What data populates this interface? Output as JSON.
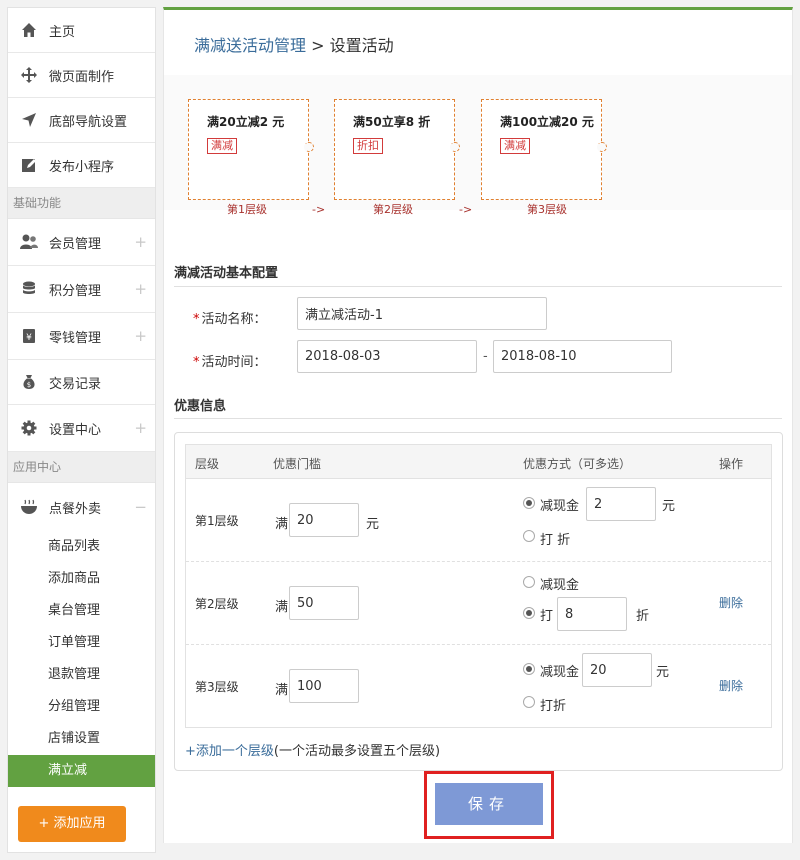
{
  "sidebar": {
    "top_items": [
      {
        "label": "主页",
        "icon": "home-icon"
      },
      {
        "label": "微页面制作",
        "icon": "move-icon"
      },
      {
        "label": "底部导航设置",
        "icon": "navigation-arrow-icon"
      },
      {
        "label": "发布小程序",
        "icon": "edit-icon"
      }
    ],
    "section_basic": "基础功能",
    "basic_items": [
      {
        "label": "会员管理",
        "icon": "users-icon",
        "expander": "+"
      },
      {
        "label": "积分管理",
        "icon": "database-icon",
        "expander": "+"
      },
      {
        "label": "零钱管理",
        "icon": "wallet-icon",
        "expander": "+"
      },
      {
        "label": "交易记录",
        "icon": "money-bag-icon"
      },
      {
        "label": "设置中心",
        "icon": "gear-icon",
        "expander": "+"
      }
    ],
    "section_apps": "应用中心",
    "app_item": {
      "label": "点餐外卖",
      "icon": "food-bowl-icon",
      "expander": "−"
    },
    "sub_items": [
      "商品列表",
      "添加商品",
      "桌台管理",
      "订单管理",
      "退款管理",
      "分组管理",
      "店铺设置",
      "满立减"
    ],
    "active_sub": "满立减",
    "add_app_label": "+ 添加应用"
  },
  "breadcrumb": {
    "link": "满减送活动管理",
    "separator": " > ",
    "current": "设置活动"
  },
  "tiers_preview": [
    {
      "title": "满20立减2 元",
      "tag": "满减",
      "level": "第1层级"
    },
    {
      "title": "满50立享8 折",
      "tag": "折扣",
      "level": "第2层级"
    },
    {
      "title": "满100立减20 元",
      "tag": "满减",
      "level": "第3层级"
    }
  ],
  "arrow_text": "->",
  "basic_config": {
    "heading": "满减活动基本配置",
    "name_label": "活动名称：",
    "name_value": "满立减活动-1",
    "time_label": "活动时间：",
    "start_date": "2018-08-03",
    "date_sep": "-",
    "end_date": "2018-08-10"
  },
  "discount": {
    "heading": "优惠信息",
    "headers": [
      "层级",
      "优惠门槛",
      "优惠方式（可多选）",
      "操作"
    ],
    "threshold_prefix": "满",
    "threshold_unit": "元",
    "rows": [
      {
        "level": "第1层级",
        "threshold": "20",
        "opt1_label": "减现金",
        "opt1_value": "2",
        "opt1_unit": "元",
        "opt2_label": "打 折",
        "selected": "opt1",
        "action": ""
      },
      {
        "level": "第2层级",
        "threshold": "50",
        "opt1_label": "减现金",
        "opt2_label": "打",
        "opt2_value": "8",
        "opt2_unit": "折",
        "selected": "opt2",
        "action": "删除"
      },
      {
        "level": "第3层级",
        "threshold": "100",
        "opt1_label": "减现金",
        "opt1_value": "20",
        "opt1_unit": "元",
        "opt2_label": "打折",
        "selected": "opt1",
        "action": "删除"
      }
    ],
    "add_link": "+添加一个层级",
    "add_note": "(一个活动最多设置五个层级)"
  },
  "save_label": "保存",
  "colors": {
    "accent_green": "#62a141",
    "orange": "#f08a1c",
    "link": "#3a6c9a",
    "save": "#7e99d6",
    "highlight": "#e02020"
  }
}
